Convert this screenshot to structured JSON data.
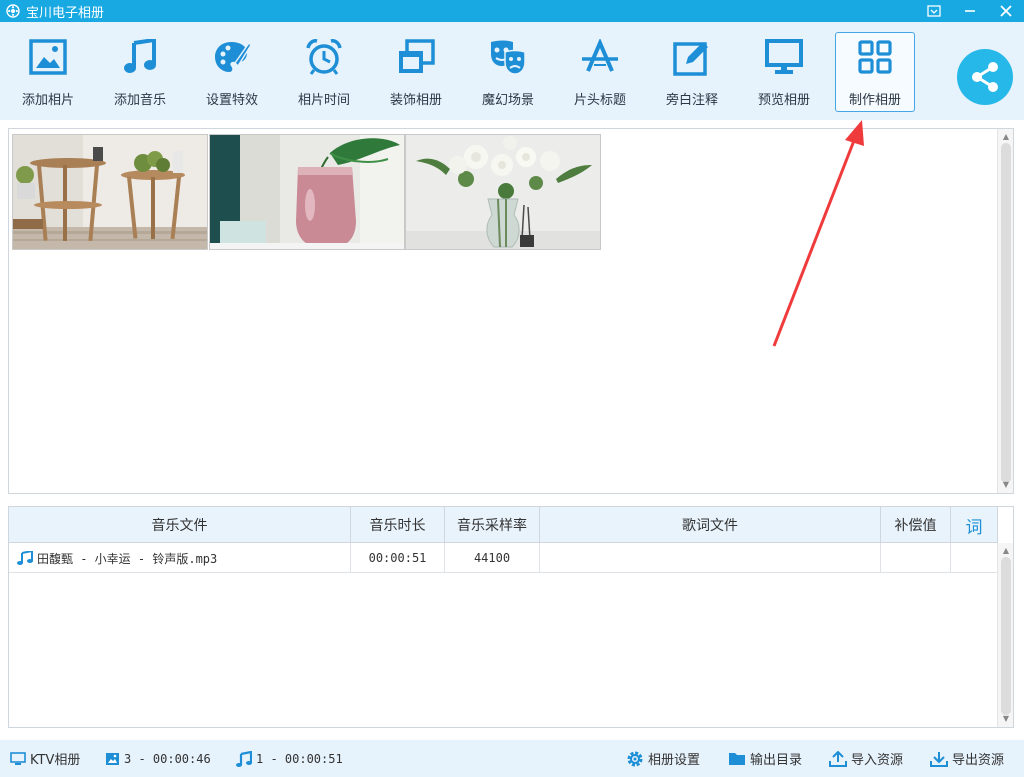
{
  "app": {
    "title": "宝川电子相册"
  },
  "toolbar": {
    "items": [
      {
        "label": "添加相片",
        "icon": "add-photo-icon"
      },
      {
        "label": "添加音乐",
        "icon": "music-note-icon"
      },
      {
        "label": "设置特效",
        "icon": "palette-icon"
      },
      {
        "label": "相片时间",
        "icon": "alarm-clock-icon"
      },
      {
        "label": "装饰相册",
        "icon": "window-stack-icon"
      },
      {
        "label": "魔幻场景",
        "icon": "masks-icon"
      },
      {
        "label": "片头标题",
        "icon": "title-a-icon"
      },
      {
        "label": "旁白注释",
        "icon": "edit-note-icon"
      },
      {
        "label": "预览相册",
        "icon": "monitor-icon"
      },
      {
        "label": "制作相册",
        "icon": "grid-icon",
        "active": true
      }
    ],
    "share_icon": "share-icon"
  },
  "photos": [
    {
      "name": "wooden-stools-photo"
    },
    {
      "name": "pink-vase-photo"
    },
    {
      "name": "white-flowers-photo"
    }
  ],
  "music_table": {
    "headers": [
      "音乐文件",
      "音乐时长",
      "音乐采样率",
      "歌词文件",
      "补偿值",
      "词"
    ],
    "rows": [
      {
        "file": "田馥甄 - 小幸运 - 铃声版.mp3",
        "duration": "00:00:51",
        "sample_rate": "44100",
        "lyrics": "",
        "offset": ""
      }
    ]
  },
  "status": {
    "mode": "KTV相册",
    "photo_summary": "3 - 00:00:46",
    "music_summary": "1 - 00:00:51",
    "settings": "相册设置",
    "output_dir": "输出目录",
    "import": "导入资源",
    "export": "导出资源"
  },
  "colors": {
    "accent": "#18a9e3",
    "toolbar_bg": "#e6f2fc",
    "icon_blue": "#1e8fd6",
    "annotation_arrow": "#ef3b3b"
  }
}
